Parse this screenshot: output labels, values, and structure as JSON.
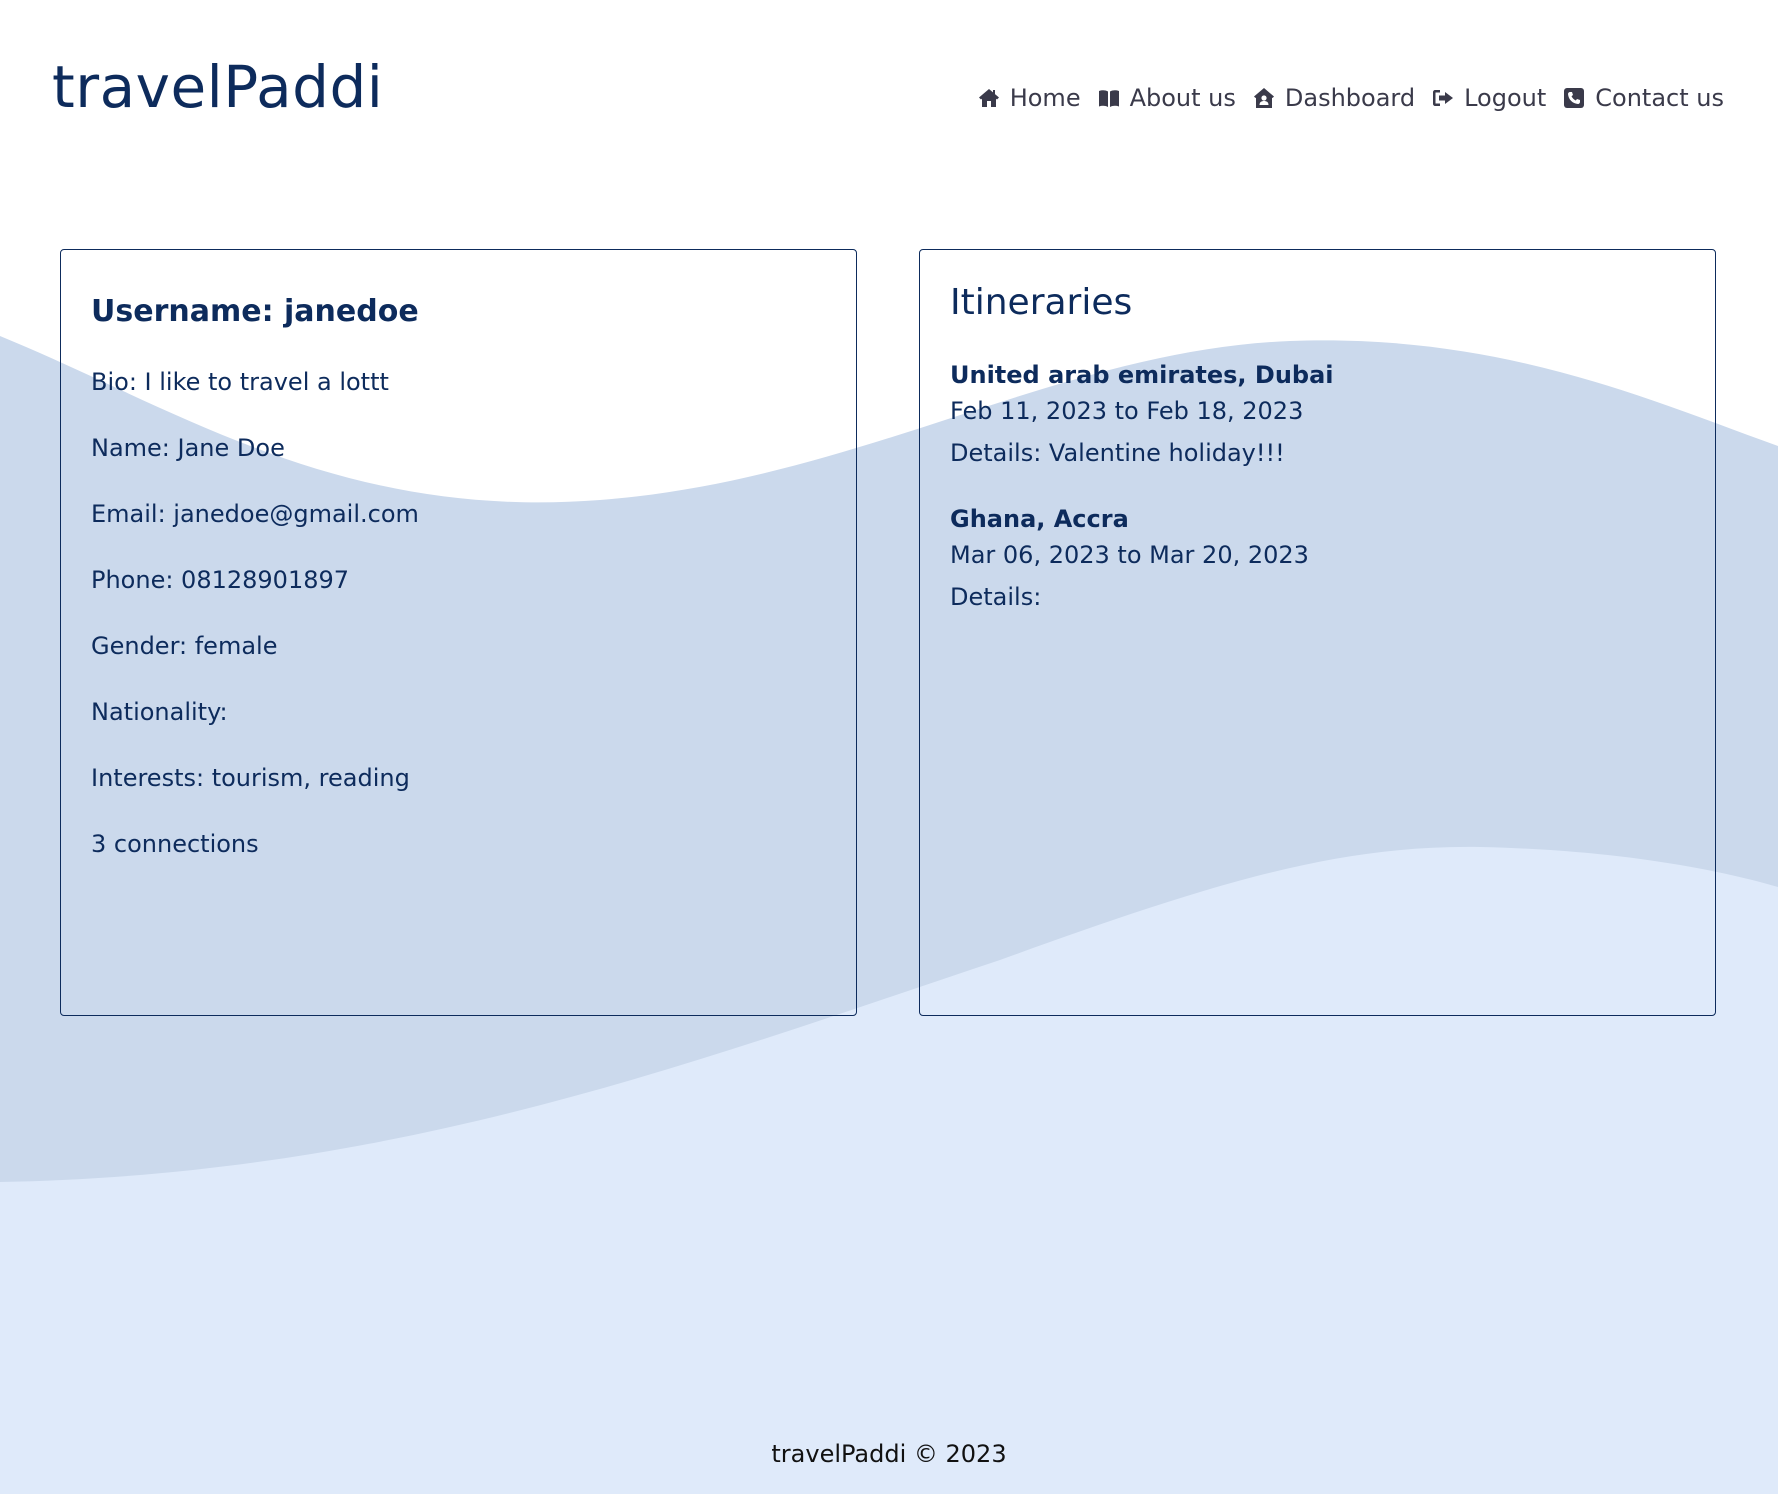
{
  "brand": {
    "logo_text": "travelPaddi"
  },
  "nav": {
    "items": [
      {
        "label": "Home",
        "icon": "home-icon"
      },
      {
        "label": "About us",
        "icon": "book-icon"
      },
      {
        "label": "Dashboard",
        "icon": "house-user-icon"
      },
      {
        "label": "Logout",
        "icon": "logout-icon"
      },
      {
        "label": "Contact us",
        "icon": "phone-icon"
      }
    ]
  },
  "profile": {
    "username": "Username: janedoe",
    "bio": "Bio: I like to travel a lottt",
    "name": "Name: Jane Doe",
    "email": "Email: janedoe@gmail.com",
    "phone": "Phone: 08128901897",
    "gender": "Gender: female",
    "nationality": "Nationality:",
    "interests": "Interests: tourism, reading",
    "connections": "3 connections"
  },
  "itineraries": {
    "title": "Itineraries",
    "items": [
      {
        "place": "United arab emirates, Dubai",
        "dates": "Feb 11, 2023 to Feb 18, 2023",
        "details": "Details: Valentine holiday!!!"
      },
      {
        "place": "Ghana, Accra",
        "dates": "Mar 06, 2023 to Mar 20, 2023",
        "details": "Details:"
      }
    ]
  },
  "footer": {
    "text": "travelPaddi © 2023"
  },
  "colors": {
    "brand_navy": "#0d2b5c",
    "wave_dark": "#cbd9ec",
    "wave_light": "#dfeafa",
    "background": "#ffffff"
  }
}
